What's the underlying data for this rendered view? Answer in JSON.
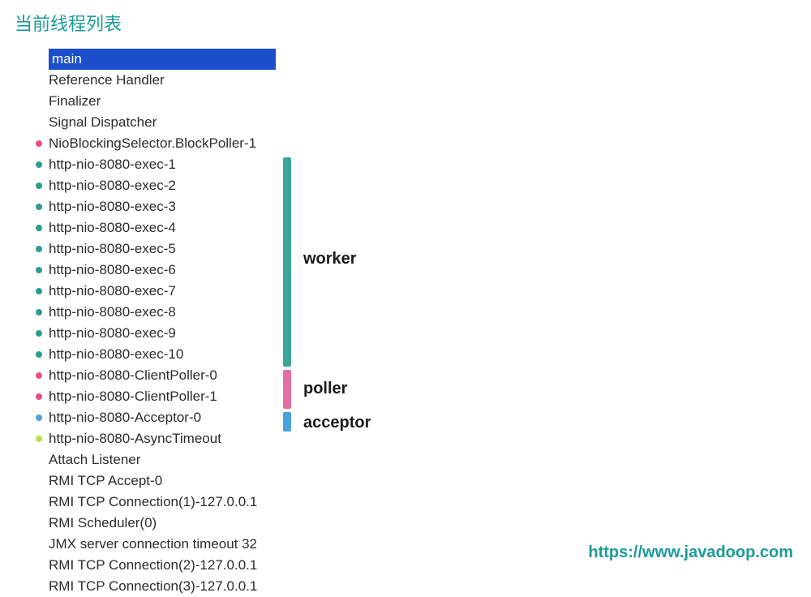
{
  "title": "当前线程列表",
  "selected_thread": "main",
  "groups": {
    "worker": {
      "label": "worker",
      "color": "#3aa698"
    },
    "poller": {
      "label": "poller",
      "color": "#e56fa6"
    },
    "acceptor": {
      "label": "acceptor",
      "color": "#4aa3e0"
    }
  },
  "threads": [
    {
      "name": "main",
      "bullet": null,
      "selected": true
    },
    {
      "name": "Reference Handler",
      "bullet": null
    },
    {
      "name": "Finalizer",
      "bullet": null
    },
    {
      "name": "Signal Dispatcher",
      "bullet": null
    },
    {
      "name": "NioBlockingSelector.BlockPoller-1",
      "bullet": "pink"
    },
    {
      "name": "http-nio-8080-exec-1",
      "bullet": "teal",
      "group": "worker"
    },
    {
      "name": "http-nio-8080-exec-2",
      "bullet": "teal",
      "group": "worker"
    },
    {
      "name": "http-nio-8080-exec-3",
      "bullet": "teal",
      "group": "worker"
    },
    {
      "name": "http-nio-8080-exec-4",
      "bullet": "teal",
      "group": "worker"
    },
    {
      "name": "http-nio-8080-exec-5",
      "bullet": "teal",
      "group": "worker"
    },
    {
      "name": "http-nio-8080-exec-6",
      "bullet": "teal",
      "group": "worker"
    },
    {
      "name": "http-nio-8080-exec-7",
      "bullet": "teal",
      "group": "worker"
    },
    {
      "name": "http-nio-8080-exec-8",
      "bullet": "teal",
      "group": "worker"
    },
    {
      "name": "http-nio-8080-exec-9",
      "bullet": "teal",
      "group": "worker"
    },
    {
      "name": "http-nio-8080-exec-10",
      "bullet": "teal",
      "group": "worker"
    },
    {
      "name": "http-nio-8080-ClientPoller-0",
      "bullet": "pink",
      "group": "poller"
    },
    {
      "name": "http-nio-8080-ClientPoller-1",
      "bullet": "pink",
      "group": "poller"
    },
    {
      "name": "http-nio-8080-Acceptor-0",
      "bullet": "blue",
      "group": "acceptor"
    },
    {
      "name": "http-nio-8080-AsyncTimeout",
      "bullet": "lime"
    },
    {
      "name": "Attach Listener",
      "bullet": null
    },
    {
      "name": "RMI TCP Accept-0",
      "bullet": null
    },
    {
      "name": "RMI TCP Connection(1)-127.0.0.1",
      "bullet": null
    },
    {
      "name": "RMI Scheduler(0)",
      "bullet": null
    },
    {
      "name": "JMX server connection timeout 32",
      "bullet": null
    },
    {
      "name": "RMI TCP Connection(2)-127.0.0.1",
      "bullet": null
    },
    {
      "name": "RMI TCP Connection(3)-127.0.0.1",
      "bullet": null
    }
  ],
  "footer_url": "https://www.javadoop.com"
}
